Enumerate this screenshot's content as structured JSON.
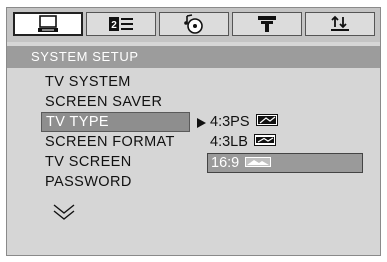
{
  "tabs": [
    {
      "icon": "monitor-icon",
      "active": true
    },
    {
      "icon": "language-icon",
      "active": false
    },
    {
      "icon": "audio-disc-icon",
      "active": false
    },
    {
      "icon": "video-icon",
      "active": false
    },
    {
      "icon": "preferences-icon",
      "active": false
    }
  ],
  "header": {
    "title": "SYSTEM SETUP"
  },
  "menu": {
    "items": [
      {
        "label": "TV SYSTEM"
      },
      {
        "label": "SCREEN SAVER"
      },
      {
        "label": "TV TYPE"
      },
      {
        "label": "SCREEN FORMAT"
      },
      {
        "label": "TV SCREEN"
      },
      {
        "label": "PASSWORD"
      }
    ],
    "selected_index": 2
  },
  "options": {
    "items": [
      {
        "label": "4:3PS",
        "icon": "pan-scan-icon"
      },
      {
        "label": "4:3LB",
        "icon": "letterbox-icon"
      },
      {
        "label": "16:9",
        "icon": "widescreen-icon"
      }
    ],
    "selected_index": 2
  },
  "colors": {
    "background": "#d6d6d6",
    "header": "#9c9c9c",
    "highlight": "#8e8e8e",
    "text": "#111111",
    "highlight_text": "#ffffff"
  }
}
